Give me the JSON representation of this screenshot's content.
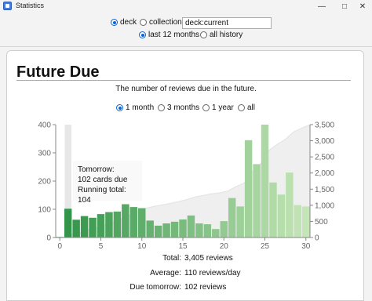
{
  "window": {
    "title": "Statistics"
  },
  "controls": {
    "scope": {
      "deck_label": "deck",
      "collection_label": "collection",
      "search_value": "deck:current",
      "selected": "deck"
    },
    "period": {
      "last12_label": "last 12 months",
      "all_label": "all history",
      "selected": "last12"
    }
  },
  "section": {
    "title": "Future Due",
    "subtitle": "The number of reviews due in the future.",
    "range_options": [
      "1 month",
      "3 months",
      "1 year",
      "all"
    ],
    "range_selected": "1 month"
  },
  "tooltip": {
    "line1": "Tomorrow:",
    "line2": "102 cards due",
    "line3": "Running total: 104"
  },
  "stats": {
    "total_label": "Total:",
    "total_value": "3,405 reviews",
    "average_label": "Average:",
    "average_value": "110 reviews/day",
    "tomorrow_label": "Due tomorrow:",
    "tomorrow_value": "102 reviews"
  },
  "chart_data": {
    "type": "bar",
    "x": [
      0,
      1,
      2,
      3,
      4,
      5,
      6,
      7,
      8,
      9,
      10,
      11,
      12,
      13,
      14,
      15,
      16,
      17,
      18,
      19,
      20,
      21,
      22,
      23,
      24,
      25,
      26,
      27,
      28,
      29,
      30
    ],
    "values": [
      2,
      102,
      63,
      76,
      70,
      83,
      90,
      92,
      118,
      108,
      104,
      60,
      42,
      50,
      56,
      64,
      78,
      50,
      47,
      30,
      58,
      140,
      110,
      345,
      260,
      400,
      195,
      152,
      230,
      115,
      110
    ],
    "cumulative_max": 3405,
    "xlim": [
      0,
      31
    ],
    "ylim_left": [
      0,
      400
    ],
    "ylim_right": [
      0,
      3500
    ],
    "x_ticks": [
      0,
      5,
      10,
      15,
      20,
      25,
      30
    ],
    "y_ticks_left": [
      0,
      100,
      200,
      300,
      400
    ],
    "y_ticks_right": [
      "0",
      "500",
      "1,000",
      "1,500",
      "2,000",
      "2,500",
      "3,000",
      "3,500"
    ],
    "highlight_x": 1,
    "colors": {
      "bar_light": "#c4e6b6",
      "bar_dark": "#2e9246",
      "running_total_fill": "#efefef",
      "highlight": "#e7e7e7"
    }
  }
}
